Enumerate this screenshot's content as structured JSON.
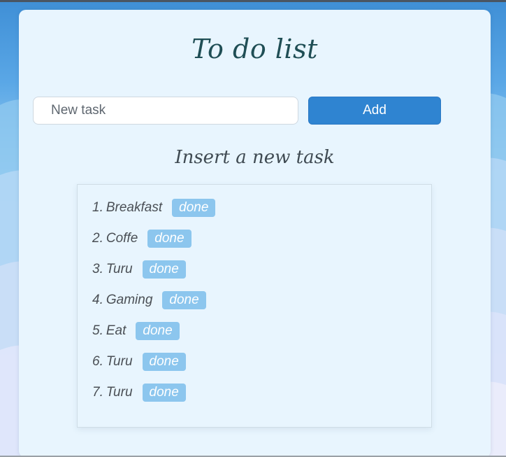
{
  "app": {
    "title": "To do list",
    "subtitle": "Insert a new task"
  },
  "form": {
    "input_placeholder": "New task",
    "input_value": "",
    "add_label": "Add"
  },
  "tasks": [
    {
      "number": "1.",
      "text": "Breakfast",
      "done_label": "done"
    },
    {
      "number": "2.",
      "text": "Coffe",
      "done_label": "done"
    },
    {
      "number": "3.",
      "text": "Turu",
      "done_label": "done"
    },
    {
      "number": "4.",
      "text": "Gaming",
      "done_label": "done"
    },
    {
      "number": "5.",
      "text": "Eat",
      "done_label": "done"
    },
    {
      "number": "6.",
      "text": "Turu",
      "done_label": "done"
    },
    {
      "number": "7.",
      "text": "Turu",
      "done_label": "done"
    }
  ],
  "colors": {
    "accent": "#2f84d1",
    "done_badge": "#8cc6ee",
    "card_background": "#e8f5fe",
    "title_color": "#1f4e55"
  }
}
